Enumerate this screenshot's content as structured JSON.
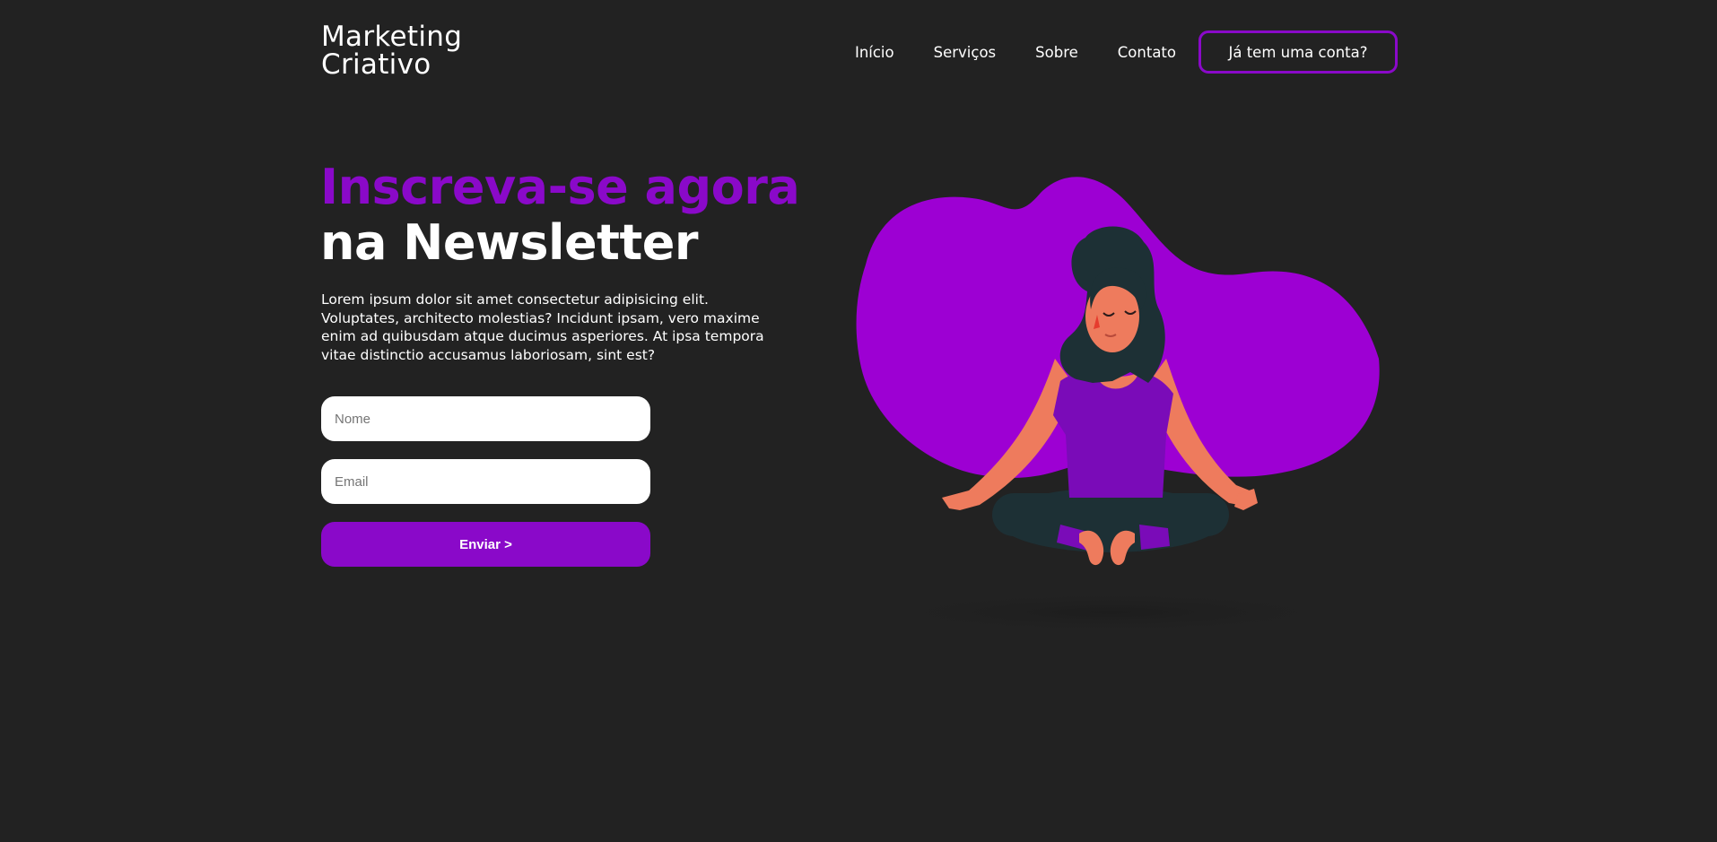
{
  "brand": {
    "line1": "Marketing",
    "line2": "Criativo"
  },
  "nav": {
    "items": [
      "Início",
      "Serviços",
      "Sobre",
      "Contato"
    ],
    "account_button": "Já tem uma conta?"
  },
  "hero": {
    "title_accent": "Inscreva-se agora",
    "title_rest": "na Newsletter",
    "description": "Lorem ipsum dolor sit amet consectetur adipisicing elit. Voluptates, architecto molestias? Incidunt ipsam, vero maxime enim ad quibusdam atque ducimus asperiores. At ipsa tempora vitae distinctio accusamus laboriosam, sint est?"
  },
  "form": {
    "name_placeholder": "Nome",
    "email_placeholder": "Email",
    "submit_label": "Enviar >"
  },
  "colors": {
    "background": "#222222",
    "accent": "#8a09c9",
    "blob": "#9d00d3",
    "text": "#ffffff"
  },
  "icons": {
    "illustration": "meditating-woman-illustration"
  }
}
